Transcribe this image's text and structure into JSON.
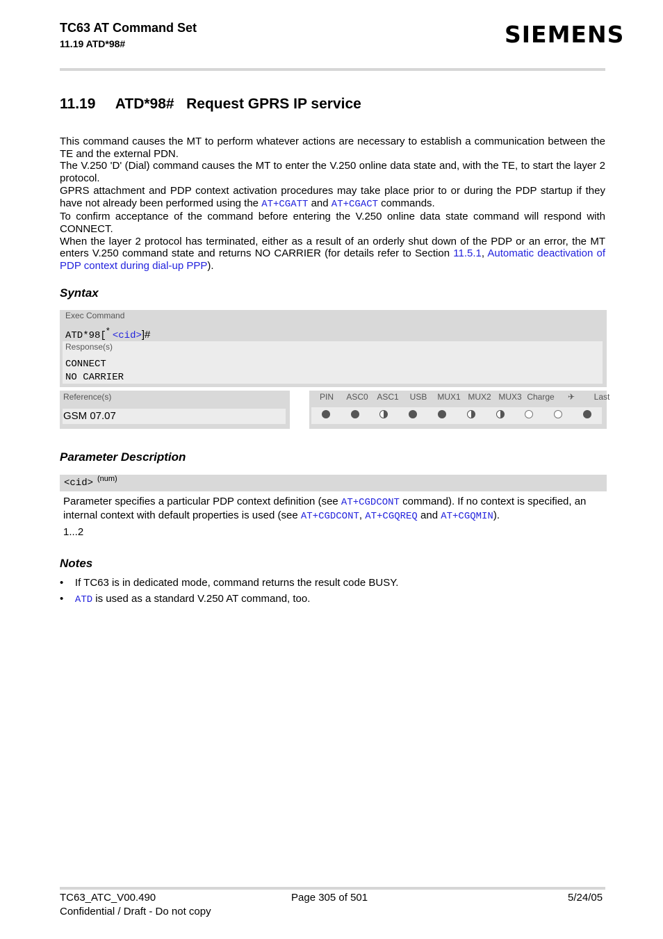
{
  "header": {
    "title": "TC63 AT Command Set",
    "section": "11.19 ATD*98#",
    "logo": "SIEMENS"
  },
  "heading": "11.19     ATD*98#   Request GPRS IP service",
  "paragraphs": {
    "p1": "This command causes the MT to perform whatever actions are necessary to establish a communication between the TE and the external PDN.",
    "p2": "The V.250 'D' (Dial) command causes the MT to enter the V.250 online data state and, with the TE, to start the layer 2 protocol.",
    "p3a": "GPRS attachment and PDP context activation procedures may take place prior to or during the PDP startup if they have not already been performed using the ",
    "p3_link1": "AT+CGATT",
    "p3b": " and ",
    "p3_link2": "AT+CGACT",
    "p3c": " commands.",
    "p4": "To confirm acceptance of the command before entering the V.250 online data state command will respond with CONNECT.",
    "p5a": "When the layer 2 protocol has terminated, either as a result of an orderly shut down of the PDP or an error, the MT enters V.250 command state and returns NO CARRIER (for details refer to Section ",
    "p5_link1": "11.5.1",
    "p5b": ", ",
    "p5_link2": "Automatic deactivation of PDP context during dial-up PPP",
    "p5c": ")."
  },
  "syntax": {
    "heading": "Syntax",
    "exec_label": "Exec Command",
    "cmd_prefix": "ATD*98[",
    "cmd_star": "*",
    "cmd_param": "<cid>",
    "cmd_suffix": "]#",
    "response_label": "Response(s)",
    "responses": [
      "CONNECT",
      "NO CARRIER"
    ],
    "reference_label": "Reference(s)",
    "reference": "GSM 07.07",
    "columns": [
      "PIN",
      "ASC0",
      "ASC1",
      "USB",
      "MUX1",
      "MUX2",
      "MUX3",
      "Charge",
      "✈",
      "Last"
    ],
    "support": [
      "full",
      "full",
      "half",
      "full",
      "full",
      "half",
      "half",
      "empty",
      "empty",
      "full"
    ]
  },
  "params": {
    "heading": "Parameter Description",
    "name": "<cid>",
    "type": "(num)",
    "desc_a": "Parameter specifies a particular PDP context definition (see ",
    "link1": "AT+CGDCONT",
    "desc_b": " command). If no context is specified, an internal context with default properties is used (see ",
    "link2": "AT+CGDCONT",
    "desc_c": ", ",
    "link3": "AT+CGQREQ",
    "desc_d": " and ",
    "link4": "AT+CGQMIN",
    "desc_e": ").",
    "range": "1...2"
  },
  "notes": {
    "heading": "Notes",
    "n1": "If TC63 is in dedicated mode, command returns the result code BUSY.",
    "n2_link": "ATD",
    "n2": " is used as a standard V.250 AT command, too."
  },
  "footer": {
    "doc": "TC63_ATC_V00.490",
    "page": "Page 305 of 501",
    "date": "5/24/05",
    "conf": "Confidential / Draft - Do not copy"
  }
}
